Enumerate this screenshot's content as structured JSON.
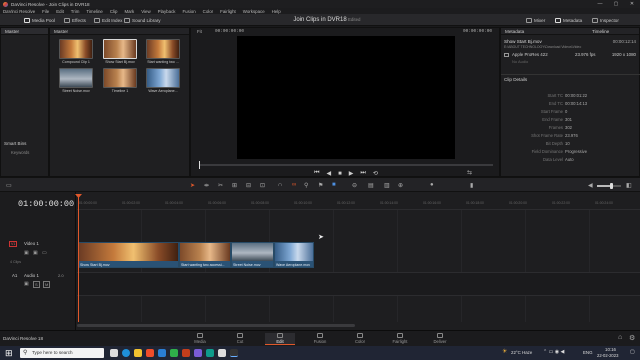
{
  "window": {
    "title": "DaVinci Resolve - Join Clips in DVR18",
    "minimize": "—",
    "maximize": "▢",
    "close": "✕"
  },
  "menu": [
    "DaVinci Resolve",
    "File",
    "Edit",
    "Trim",
    "Timeline",
    "Clip",
    "Mark",
    "View",
    "Playback",
    "Fusion",
    "Color",
    "Fairlight",
    "Workspace",
    "Help"
  ],
  "toolbar": {
    "media_pool": "Media Pool",
    "effects": "Effects",
    "edit_index": "Edit Index",
    "sound_library": "Sound Library",
    "project_title": "Join Clips in DVR18",
    "edited": "Edited",
    "mixer": "Mixer",
    "metadata": "Metadata",
    "inspector": "Inspector"
  },
  "left_panel": {
    "master": "Master",
    "smart_bins": "Smart Bins",
    "keywords": "Keywords"
  },
  "media_pool": {
    "header": "Master",
    "clips": [
      {
        "label": "Compound Clip 1"
      },
      {
        "label": "Show Start Bj.mov"
      },
      {
        "label": "Start wanting two ..."
      },
      {
        "label": "Street Noise.mov"
      },
      {
        "label": "Timeline 1"
      },
      {
        "label": "Wave Aeroplane..."
      }
    ]
  },
  "viewer": {
    "fit": "Fit",
    "timecode": "00:00:00:00",
    "timecode_right": "00:00:00:00",
    "timeline_name": "Timeline"
  },
  "metadata": {
    "header": "Metadata",
    "clip_name": "Show Start Bj.mov",
    "clip_path": "E:\\ABOUT TECHNOLOGY\\Download Videos\\Video",
    "clip_duration": "00:00:12:14",
    "codec": "Apple ProRes 422",
    "fps": "23.976 fps",
    "resolution": "1920 x 1080",
    "no_audio": "No Audio",
    "details_header": "Clip Details",
    "details": [
      {
        "k": "Start TC",
        "v": "00:00:01:22"
      },
      {
        "k": "End TC",
        "v": "00:00:14:13"
      },
      {
        "k": "Start Frame",
        "v": "0"
      },
      {
        "k": "End Frame",
        "v": "301"
      },
      {
        "k": "Frames",
        "v": "302"
      },
      {
        "k": "Shot Frame Rate",
        "v": "23.976"
      },
      {
        "k": "Bit Depth",
        "v": "10"
      },
      {
        "k": "Field Dominance",
        "v": "Progressive"
      },
      {
        "k": "Data Level",
        "v": "Auto"
      }
    ]
  },
  "timeline": {
    "timecode": "01:00:00:00",
    "ticks": [
      "01:00:00:00",
      "01:00:02:00",
      "01:00:04:00",
      "01:00:06:00",
      "01:00:08:00",
      "01:00:10:00",
      "01:00:12:00",
      "01:00:14:00",
      "01:00:16:00",
      "01:00:18:00",
      "01:00:20:00",
      "01:00:22:00",
      "01:00:24:00"
    ],
    "video_track": {
      "badge": "V1",
      "name": "Video 1",
      "clip_count": "4 Clips"
    },
    "audio_track": {
      "badge": "A1",
      "name": "Audio 1",
      "value": "2.0"
    },
    "clips": [
      {
        "name": "Show Start Bj.mov"
      },
      {
        "name": "Start wanting two accessi..."
      },
      {
        "name": "Street Noise.mov"
      },
      {
        "name": "Wave Aeroplane.mov"
      }
    ]
  },
  "pages": [
    "Media",
    "Cut",
    "Edit",
    "Fusion",
    "Color",
    "Fairlight",
    "Deliver"
  ],
  "active_page": "Edit",
  "app_footer": "DaVinci Resolve 18",
  "taskbar": {
    "search_placeholder": "Type here to search",
    "weather": "22°C Haze",
    "language": "ENG",
    "time": "10:16",
    "date": "22-02-2023"
  },
  "colors": {
    "accent": "#e0582b",
    "clip_blue": "#2a5275",
    "taskbar": "#202534"
  }
}
